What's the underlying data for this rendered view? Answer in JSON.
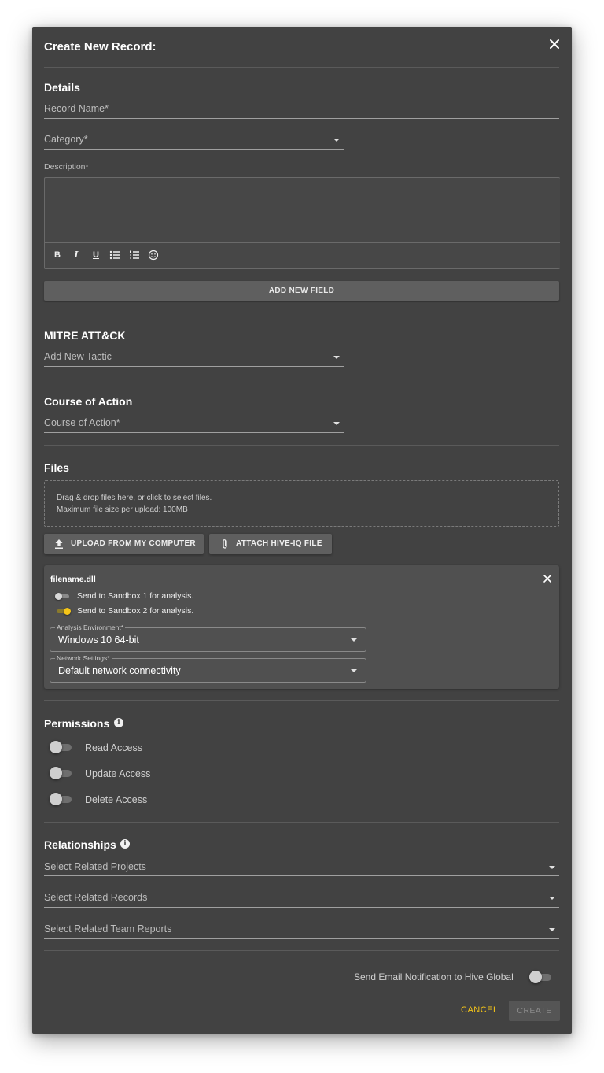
{
  "dialog": {
    "title": "Create New Record:"
  },
  "details": {
    "title": "Details",
    "record_name_label": "Record Name*",
    "category_label": "Category*",
    "description_label": "Description*",
    "add_field_label": "ADD NEW FIELD",
    "toolbar": {
      "bold": "B",
      "italic": "I",
      "underline": "U"
    }
  },
  "mitre": {
    "title": "MITRE ATT&CK",
    "tactic_label": "Add New Tactic"
  },
  "course": {
    "title": "Course of Action",
    "field_label": "Course of Action*"
  },
  "files": {
    "title": "Files",
    "dropzone_line1": "Drag & drop files here, or click to select files.",
    "dropzone_line2": "Maximum file size per upload: 100MB",
    "upload_label": "UPLOAD FROM MY COMPUTER",
    "attach_label": "ATTACH HIVE-IQ FILE",
    "file": {
      "name": "filename.dll",
      "sandbox1": {
        "label": "Send to Sandbox 1 for analysis.",
        "on": false
      },
      "sandbox2": {
        "label": "Send to Sandbox 2 for analysis.",
        "on": true
      },
      "analysis_env": {
        "label": "Analysis Environment*",
        "value": "Windows 10 64-bit"
      },
      "network": {
        "label": "Network Settings*",
        "value": "Default network connectivity"
      }
    }
  },
  "permissions": {
    "title": "Permissions",
    "items": [
      {
        "label": "Read Access",
        "on": false
      },
      {
        "label": "Update Access",
        "on": false
      },
      {
        "label": "Delete Access",
        "on": false
      }
    ]
  },
  "relationships": {
    "title": "Relationships",
    "projects_label": "Select Related Projects",
    "records_label": "Select Related Records",
    "team_reports_label": "Select Related Team Reports"
  },
  "footer": {
    "email_label": "Send Email Notification to Hive Global",
    "email_on": false,
    "cancel_label": "CANCEL",
    "create_label": "CREATE"
  },
  "colors": {
    "accent": "#f5c518",
    "dialog_bg": "#424242"
  },
  "icons": [
    "close-icon",
    "bold-icon",
    "italic-icon",
    "underline-icon",
    "bullet-list-icon",
    "numbered-list-icon",
    "emoji-icon",
    "upload-icon",
    "paperclip-icon",
    "info-icon",
    "dropdown-caret-icon"
  ]
}
